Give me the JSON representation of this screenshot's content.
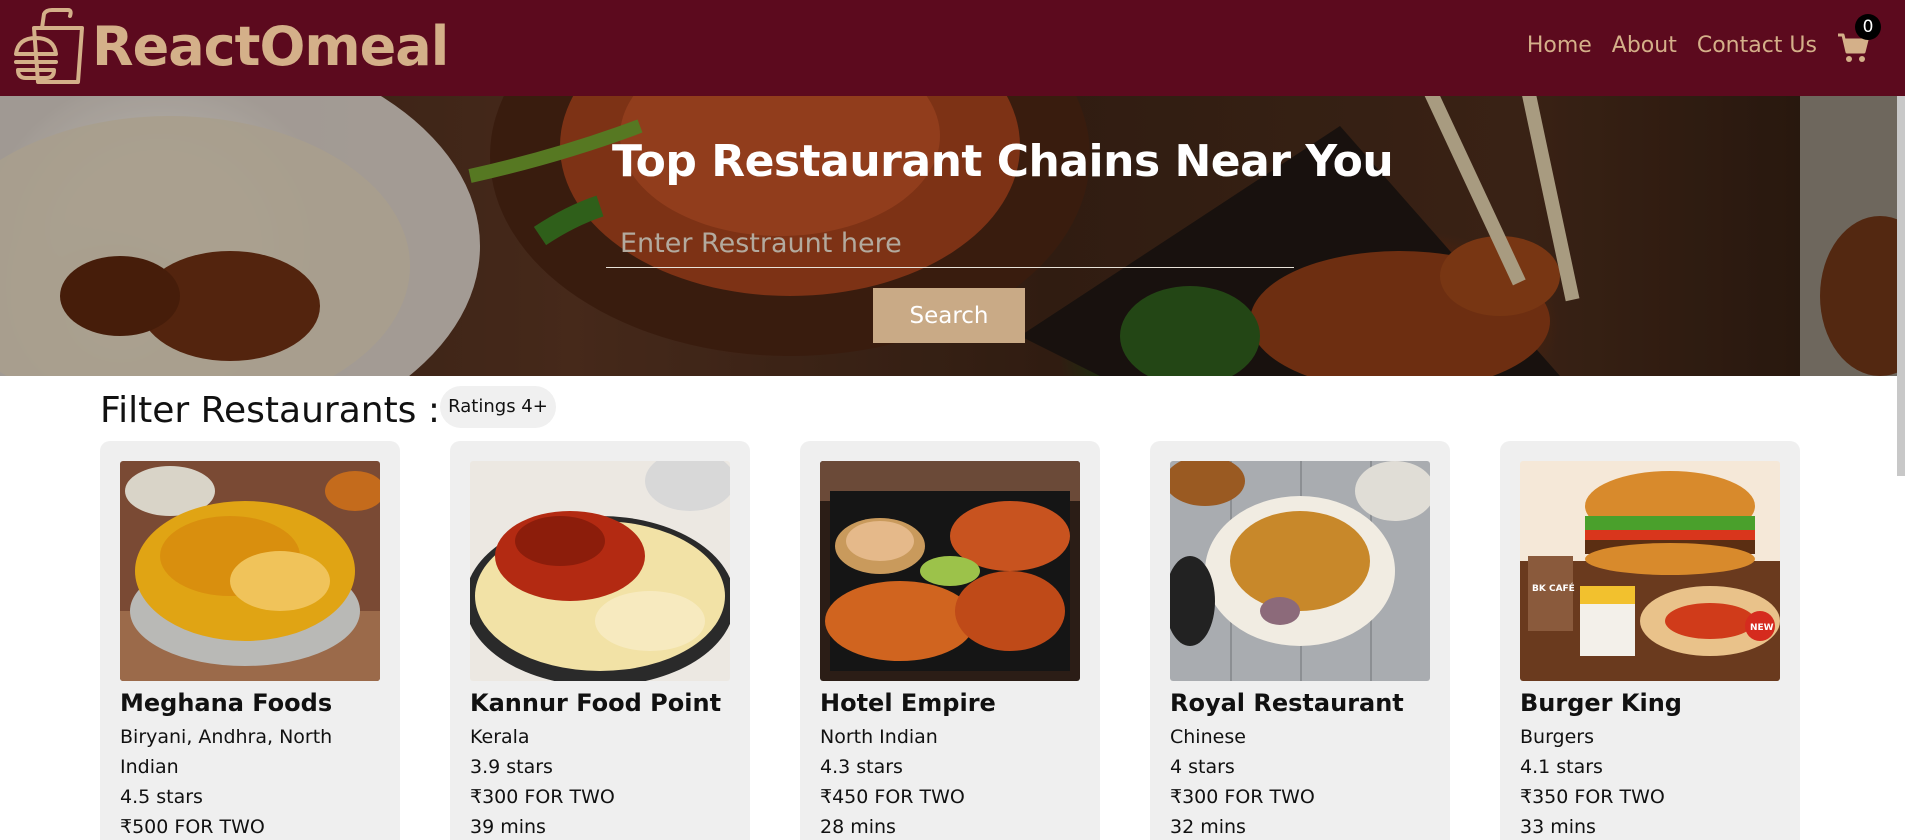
{
  "header": {
    "brand": "ReactOmeal",
    "nav": [
      "Home",
      "About",
      "Contact Us"
    ],
    "cart_count": "0",
    "colors": {
      "bar": "#5c0a1e",
      "accent": "#d4b089"
    }
  },
  "hero": {
    "title": "Top Restaurant Chains Near You",
    "search_placeholder": "Enter Restraunt here",
    "search_button": "Search"
  },
  "filter": {
    "title": "Filter Restaurants :",
    "chip": "Ratings 4+"
  },
  "restaurants": [
    {
      "name": "Meghana Foods",
      "cuisine": "Biryani, Andhra, North Indian",
      "rating": "4.5 stars",
      "cost": "₹500 FOR TWO",
      "time": ""
    },
    {
      "name": "Kannur Food Point",
      "cuisine": "Kerala",
      "rating": "3.9 stars",
      "cost": "₹300 FOR TWO",
      "time": "39 mins"
    },
    {
      "name": "Hotel Empire",
      "cuisine": "North Indian",
      "rating": "4.3 stars",
      "cost": "₹450 FOR TWO",
      "time": "28 mins"
    },
    {
      "name": "Royal Restaurant",
      "cuisine": "Chinese",
      "rating": "4 stars",
      "cost": "₹300 FOR TWO",
      "time": "32 mins"
    },
    {
      "name": "Burger King",
      "cuisine": "Burgers",
      "rating": "4.1 stars",
      "cost": "₹350 FOR TWO",
      "time": "33 mins"
    }
  ],
  "image_labels": {
    "burger_cafe": "BK CAFÉ",
    "burger_new": "NEW"
  }
}
